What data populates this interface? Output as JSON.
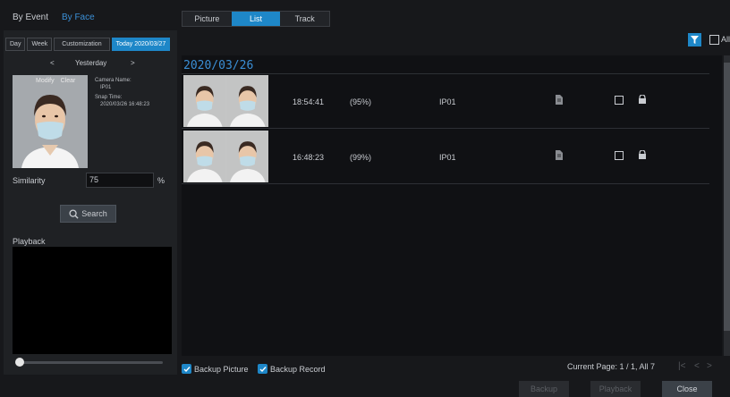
{
  "top_tabs": {
    "by_event": "By Event",
    "by_face": "By Face"
  },
  "view_tabs": [
    "Picture",
    "List",
    "Track"
  ],
  "range_tabs": {
    "day": "Day",
    "week": "Week",
    "customization": "Customization",
    "today": "Today 2020/03/27"
  },
  "nav": {
    "prev": "<",
    "label": "Yesterday",
    "next": ">"
  },
  "face_card": {
    "modify": "Modify",
    "clear": "Clear"
  },
  "info": {
    "camera_label": "Camera Name:",
    "camera": "IP01",
    "snap_label": "Snap Time:",
    "snap_time": "2020/03/26 16:48:23"
  },
  "similarity": {
    "label": "Similarity",
    "value": "75",
    "unit": "%"
  },
  "search_label": "Search",
  "playback_label": "Playback",
  "playback_slider": {
    "position": 0
  },
  "filter": {
    "all_label": "All"
  },
  "list": {
    "date": "2020/03/26",
    "rows": [
      {
        "time": "18:54:41",
        "score": "(95%)",
        "camera": "IP01"
      },
      {
        "time": "16:48:23",
        "score": "(99%)",
        "camera": "IP01"
      }
    ]
  },
  "bottom": {
    "backup_picture": "Backup Picture",
    "backup_record": "Backup Record",
    "page_info": "Current Page: 1 / 1, All 7",
    "backup": "Backup",
    "playback": "Playback",
    "close": "Close"
  },
  "colors": {
    "accent": "#1e87c8",
    "date": "#3b8fd6"
  }
}
